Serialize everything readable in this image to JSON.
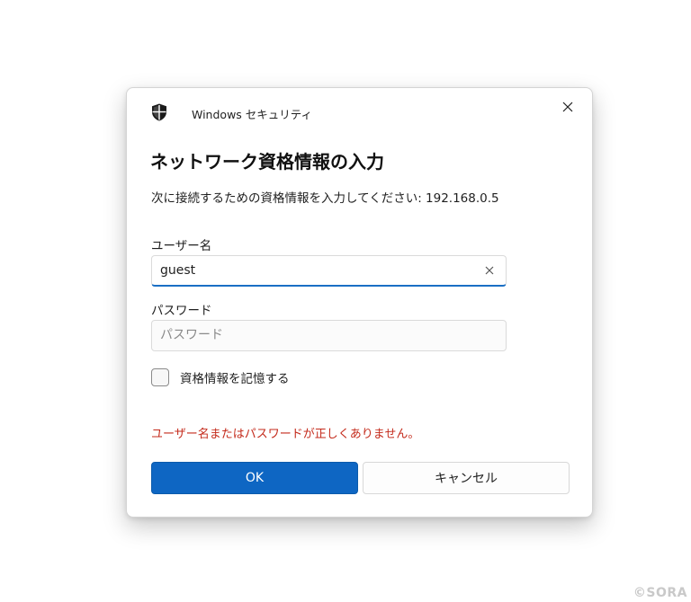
{
  "window": {
    "title": "Windows セキュリティ",
    "icon": "shield-icon",
    "close_icon": "close-icon"
  },
  "dialog": {
    "heading": "ネットワーク資格情報の入力",
    "message": "次に接続するための資格情報を入力してください: 192.168.0.5"
  },
  "username": {
    "label": "ユーザー名",
    "value": "guest",
    "clear_icon": "clear-icon"
  },
  "password": {
    "label": "パスワード",
    "value": "",
    "placeholder": "パスワード"
  },
  "remember": {
    "label": "資格情報を記憶する",
    "checked": false
  },
  "error": {
    "text": "ユーザー名またはパスワードが正しくありません。",
    "color": "#c42b1c"
  },
  "buttons": {
    "ok_label": "OK",
    "cancel_label": "キャンセル",
    "accent_color": "#0e66c3"
  },
  "watermark": "©SORA"
}
